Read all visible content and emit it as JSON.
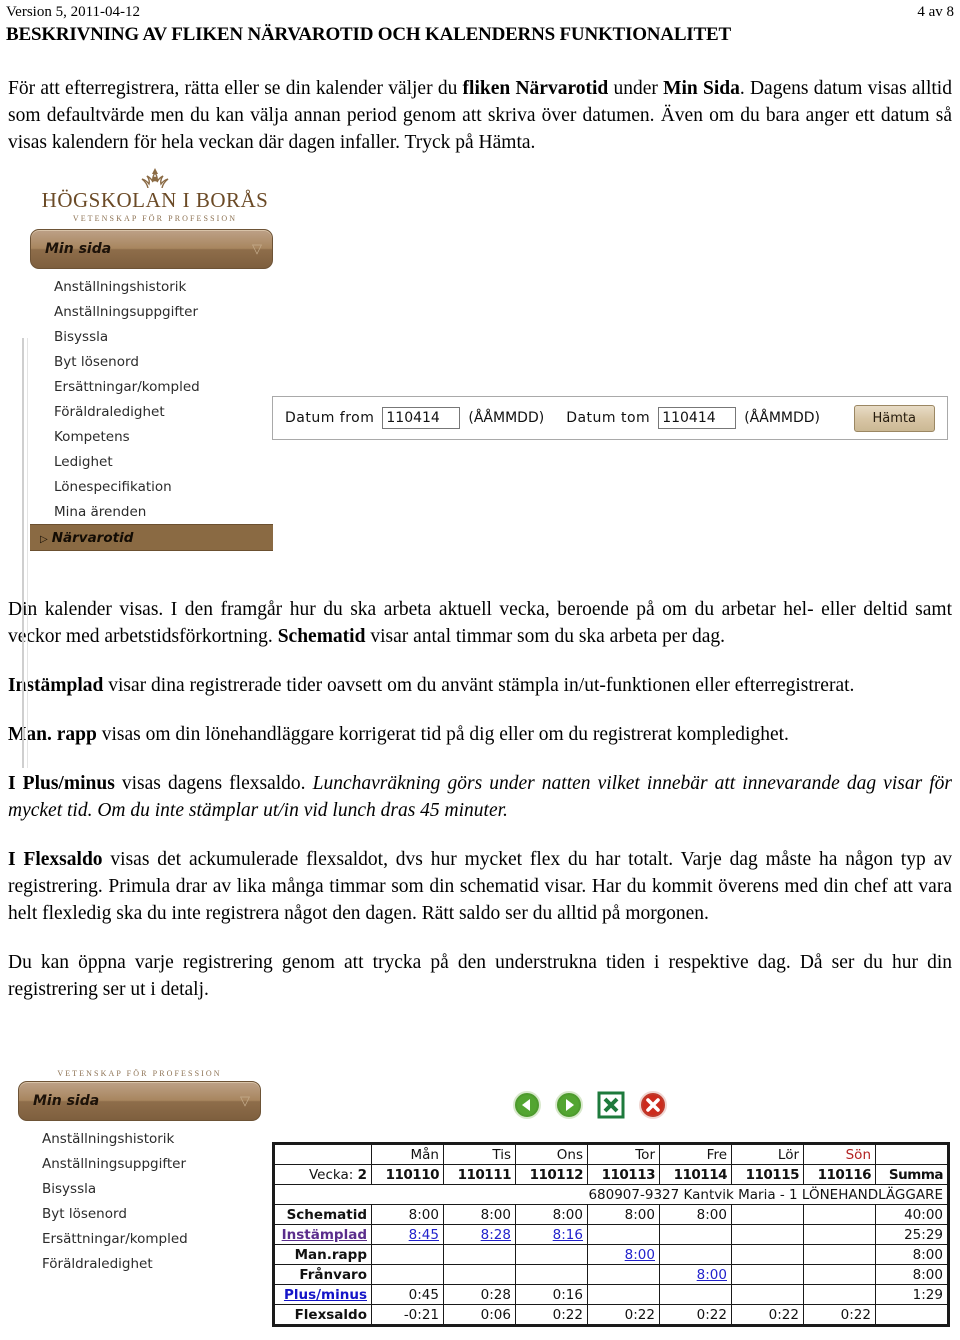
{
  "header": {
    "version": "Version 5, 2011-04-12",
    "page_number": "4 av 8",
    "title": "BESKRIVNING AV FLIKEN NÄRVAROTID OCH KALENDERNS FUNKTIONALITET"
  },
  "intro": {
    "t1": "För att efterregistrera, rätta eller se din kalender väljer du ",
    "b1": "fliken Närvarotid",
    "t2": " under ",
    "b2": "Min Sida",
    "t3": ". Dagens datum visas alltid som defaultvärde men du kan välja annan period genom att skriva över datumen. Även om du bara anger ett datum så visas kalendern för hela veckan där dagen infaller. Tryck på Hämta."
  },
  "app": {
    "logo_crest": "crest-icon",
    "logo_main": "HÖGSKOLAN I BORÅS",
    "logo_sub": "VETENSKAP FÖR PROFESSION",
    "minsida_label": "Min sida",
    "chevron": "▽",
    "menu_items": [
      "Anställningshistorik",
      "Anställningsuppgifter",
      "Bisyssla",
      "Byt lösenord",
      "Ersättningar/kompled",
      "Föräldraledighet",
      "Kompetens",
      "Ledighet",
      "Lönespecifikation",
      "Mina ärenden"
    ],
    "active_item": "Närvarotid",
    "active_arrow": "▷"
  },
  "datebar": {
    "from_label": "Datum from",
    "from_value": "110414",
    "from_format": "(ÅÅMMDD)",
    "tom_label": "Datum tom",
    "tom_value": "110414",
    "tom_format": "(ÅÅMMDD)",
    "submit_label": "Hämta"
  },
  "body": {
    "p1_a": "Din kalender visas. I den framgår hur du ska arbeta aktuell vecka, beroende på om du arbetar hel- eller deltid samt veckor med arbetstidsförkortning. ",
    "p1_b": "Schematid",
    "p1_c": " visar antal timmar som du ska arbeta per dag.",
    "p2_b": "Instämplad",
    "p2_c": " visar dina registrerade tider oavsett om du använt stämpla in/ut-funktionen eller efterregistrerat.",
    "p3_b": "Man. rapp",
    "p3_c": " visas om din lönehandläggare korrigerat tid på dig eller om du registrerat kompledighet.",
    "p4_b": "I Plus/minus",
    "p4_c": " visas dagens flexsaldo. ",
    "p4_i": "Lunchavräkning görs under natten vilket innebär att innevarande dag visar för mycket tid. Om du inte stämplar ut/in vid lunch dras 45 minuter.",
    "p5_b": " I Flexsaldo",
    "p5_c": " visas det ackumulerade flexsaldot, dvs hur mycket flex du har totalt. Varje dag måste ha någon typ av registrering. Primula drar av lika många timmar som din schematid visar. Har du kommit överens med din chef att vara helt flexledig ska du inte registrera något den dagen. Rätt saldo ser du alltid på morgonen.",
    "p6": "Du kan öppna varje registrering genom att trycka på den understrukna tiden i respektive dag. Då ser du hur din registrering ser ut i detalj."
  },
  "calendar_toolbar": {
    "back_icon": "back-arrow-icon",
    "forward_icon": "forward-arrow-icon",
    "excel_icon": "excel-export-icon",
    "close_icon": "close-icon"
  },
  "calendar": {
    "day_headers": [
      "",
      "Mån",
      "Tis",
      "Ons",
      "Tor",
      "Fre",
      "Lör",
      "Sön",
      ""
    ],
    "sunday_index": 7,
    "week_label": "Vecka: ",
    "week_number": "2",
    "dates": [
      "110110",
      "110111",
      "110112",
      "110113",
      "110114",
      "110115",
      "110116"
    ],
    "summa_label": "Summa",
    "person": "680907-9327 Kantvik Maria - 1 LÖNEHANDLÄGGARE",
    "rows": [
      {
        "label": "Schematid",
        "label_style": "plain",
        "values": [
          "8:00",
          "8:00",
          "8:00",
          "8:00",
          "8:00",
          "",
          ""
        ],
        "value_style": "plain",
        "summa": "40:00"
      },
      {
        "label": "Instämplad",
        "label_style": "purple-link",
        "values": [
          "8:45",
          "8:28",
          "8:16",
          "",
          "",
          "",
          ""
        ],
        "value_style": "link",
        "summa": "25:29"
      },
      {
        "label": "Man.rapp",
        "label_style": "plain",
        "values": [
          "",
          "",
          "",
          "8:00",
          "",
          "",
          ""
        ],
        "value_style": "link",
        "summa": "8:00"
      },
      {
        "label": "Frånvaro",
        "label_style": "plain",
        "values": [
          "",
          "",
          "",
          "",
          "8:00",
          "",
          ""
        ],
        "value_style": "link",
        "summa": "8:00"
      },
      {
        "label": "Plus/minus",
        "label_style": "blue-link",
        "values": [
          "0:45",
          "0:28",
          "0:16",
          "",
          "",
          "",
          ""
        ],
        "value_style": "red",
        "summa": "1:29"
      },
      {
        "label": "Flexsaldo",
        "label_style": "plain",
        "values": [
          "-0:21",
          "0:06",
          "0:22",
          "0:22",
          "0:22",
          "0:22",
          "0:22"
        ],
        "value_style": "plain",
        "summa": ""
      }
    ]
  },
  "sidebar2": {
    "minsida_label": "Min sida",
    "logo_sub": "VETENSKAP FÖR PROFESSION",
    "chevron": "▽",
    "menu_items": [
      "Anställningshistorik",
      "Anställningsuppgifter",
      "Bisyssla",
      "Byt lösenord",
      "Ersättningar/kompled",
      "Föräldraledighet"
    ]
  },
  "colors": {
    "brand_brown": "#8a6a43",
    "link_blue": "#2222cc",
    "link_purple": "#5a2d8c",
    "accent_red": "#c22222",
    "excel_green": "#1e7a3c"
  }
}
